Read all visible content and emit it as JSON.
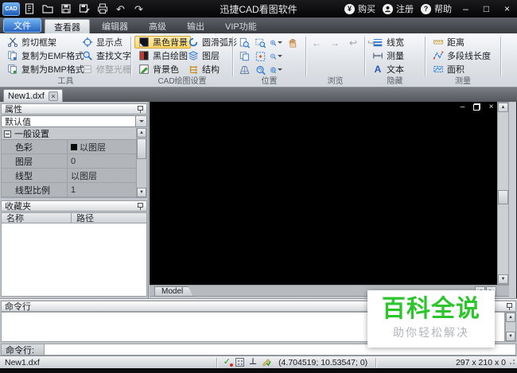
{
  "titlebar": {
    "logo": "CAD",
    "title": "迅捷CAD看图软件",
    "buy_label": "购买",
    "register_label": "注册",
    "help_label": "帮助"
  },
  "menubar": {
    "file_tab": "文件",
    "viewer_tab": "查看器",
    "editor_tab": "编辑器",
    "advanced_tab": "高级",
    "output_tab": "输出",
    "vip_tab": "VIP功能"
  },
  "ribbon": {
    "tools_group": {
      "title": "工具",
      "cut_frame": "剪切框架",
      "copy_emf": "复制为EMF格式",
      "copy_bmp": "复制为BMP格式",
      "show_point": "显示点",
      "find_text": "查找文字",
      "trim_raster": "修整光栅"
    },
    "cad_settings_group": {
      "title": "CAD绘图设置",
      "black_background": "黑色背景",
      "bw_drawing": "黑白绘图",
      "background_color": "背景色",
      "smooth_arc": "圆滑弧形",
      "layers": "图层",
      "structure": "结构"
    },
    "position_group": {
      "title": "位置"
    },
    "browse_group": {
      "title": "浏览"
    },
    "hide_group": {
      "title": "隐藏",
      "line_width": "线宽",
      "measure": "测量",
      "text": "文本"
    },
    "measure_group": {
      "title": "测量",
      "distance": "距离",
      "polyline_length": "多段线长度",
      "area": "面积"
    }
  },
  "document_tabs": {
    "tab1": "New1.dxf"
  },
  "properties_panel": {
    "title": "属性",
    "preset_value": "默认值",
    "group_general": "一般设置",
    "rows": [
      {
        "label": "色彩",
        "value": "以图层"
      },
      {
        "label": "图层",
        "value": "0"
      },
      {
        "label": "线型",
        "value": "以图层"
      },
      {
        "label": "线型比例",
        "value": "1"
      }
    ]
  },
  "favorites_panel": {
    "title": "收藏夹",
    "name_column": "名称",
    "path_column": "路径"
  },
  "canvas": {
    "model_tab": "Model"
  },
  "command_panel": {
    "title": "命令行",
    "prompt_label": "命令行:"
  },
  "statusbar": {
    "filename": "New1.dxf",
    "coordinates": "(4.704519; 10.53547; 0)",
    "dimensions": "297 x 210 x 0"
  },
  "watermark": {
    "title": "百科全说",
    "subtitle": "助你轻松解决"
  },
  "glyphs": {
    "yen": "¥",
    "question": "?",
    "minimize": "–",
    "maximize": "□",
    "close": "×",
    "undo": "↶",
    "redo": "↷",
    "back": "←",
    "forward": "→",
    "back_page": "↩",
    "forward_page": "↪",
    "up": "▲",
    "down": "▼",
    "left": "◄",
    "right": "►",
    "text_a": "A",
    "ortho": "⊥",
    "check": "✓"
  },
  "colors": {
    "accent_blue": "#2f7fd6",
    "highlight_orange": "#ffd768",
    "watermark_green": "#2cc52c",
    "canvas_black": "#000000"
  }
}
